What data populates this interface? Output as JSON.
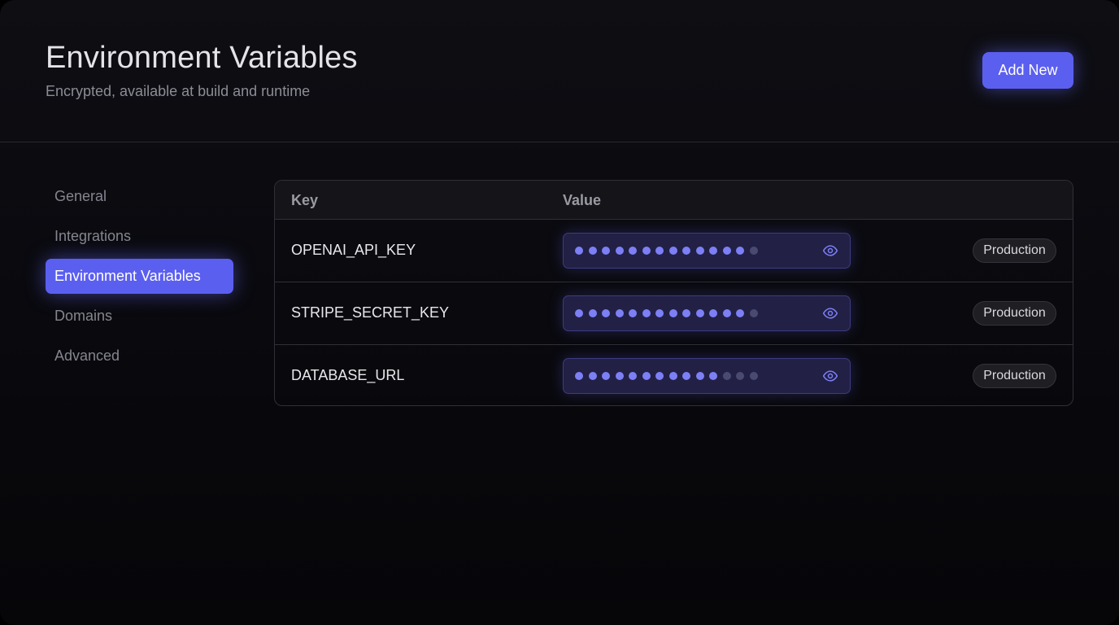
{
  "header": {
    "title": "Environment Variables",
    "subtitle": "Encrypted, available at build and runtime",
    "add_button_label": "Add New"
  },
  "sidebar": {
    "items": [
      {
        "label": "General",
        "active": false
      },
      {
        "label": "Integrations",
        "active": false
      },
      {
        "label": "Environment Variables",
        "active": true
      },
      {
        "label": "Domains",
        "active": false
      },
      {
        "label": "Advanced",
        "active": false
      }
    ]
  },
  "table": {
    "columns": {
      "key": "Key",
      "value": "Value"
    },
    "rows": [
      {
        "key": "OPENAI_API_KEY",
        "masked_dots_bright": 13,
        "masked_dots_dim": 1,
        "environment": "Production",
        "reveal_icon": "eye-icon"
      },
      {
        "key": "STRIPE_SECRET_KEY",
        "masked_dots_bright": 13,
        "masked_dots_dim": 1,
        "environment": "Production",
        "reveal_icon": "eye-icon"
      },
      {
        "key": "DATABASE_URL",
        "masked_dots_bright": 11,
        "masked_dots_dim": 3,
        "environment": "Production",
        "reveal_icon": "eye-icon"
      }
    ]
  },
  "colors": {
    "accent": "#5b5ff0",
    "dot_bright": "#7c7ff5",
    "dot_dim": "#4a4a70",
    "background": "#0a0a0f"
  }
}
